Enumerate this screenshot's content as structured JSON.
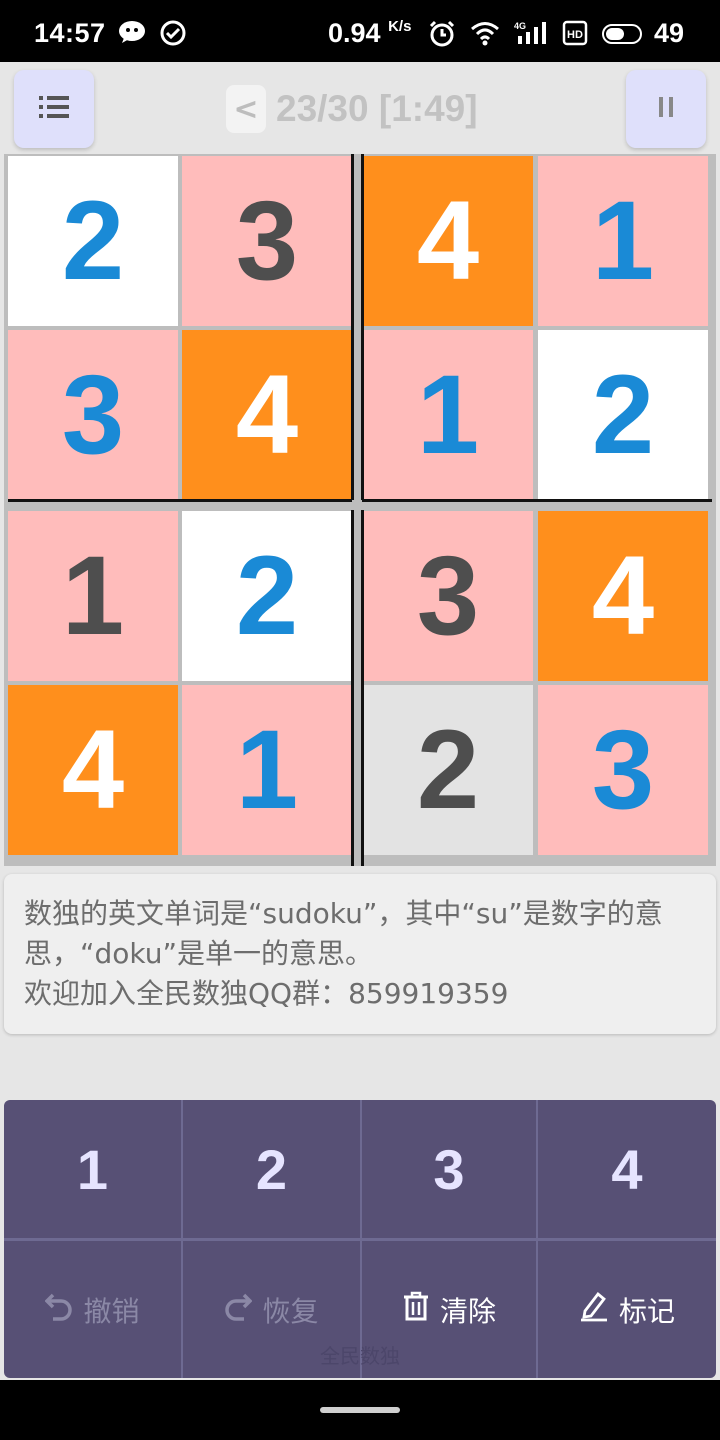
{
  "status_bar": {
    "time": "14:57",
    "net_speed": "0.94",
    "net_unit": "K/s",
    "battery_level": "49",
    "icons": [
      "wechat-icon",
      "check-circle-icon",
      "alarm-icon",
      "wifi-icon",
      "signal-4g-icon",
      "hd-icon",
      "battery-icon"
    ]
  },
  "header": {
    "back_label": "<",
    "progress": "23/30 [1:49]",
    "menu_icon": "menu-list-icon",
    "pause_icon": "pause-icon"
  },
  "board": {
    "colors": {
      "white": "#ffffff",
      "pink": "#ffbcbb",
      "orange": "#ff8f1c",
      "grey": "#e3e3e3",
      "blue": "#1a8ad6",
      "dark": "#4e4e4e",
      "light": "#ffffff"
    },
    "rows": [
      [
        {
          "value": "2",
          "bg": "white",
          "fg": "blue"
        },
        {
          "value": "3",
          "bg": "pink",
          "fg": "dark"
        },
        {
          "value": "4",
          "bg": "orange",
          "fg": "light"
        },
        {
          "value": "1",
          "bg": "pink",
          "fg": "blue"
        }
      ],
      [
        {
          "value": "3",
          "bg": "pink",
          "fg": "blue"
        },
        {
          "value": "4",
          "bg": "orange",
          "fg": "light"
        },
        {
          "value": "1",
          "bg": "pink",
          "fg": "blue"
        },
        {
          "value": "2",
          "bg": "white",
          "fg": "blue"
        }
      ],
      [
        {
          "value": "1",
          "bg": "pink",
          "fg": "dark"
        },
        {
          "value": "2",
          "bg": "white",
          "fg": "blue"
        },
        {
          "value": "3",
          "bg": "pink",
          "fg": "dark"
        },
        {
          "value": "4",
          "bg": "orange",
          "fg": "light"
        }
      ],
      [
        {
          "value": "4",
          "bg": "orange",
          "fg": "light"
        },
        {
          "value": "1",
          "bg": "pink",
          "fg": "blue"
        },
        {
          "value": "2",
          "bg": "grey",
          "fg": "dark"
        },
        {
          "value": "3",
          "bg": "pink",
          "fg": "blue"
        }
      ]
    ]
  },
  "info": {
    "line1": "数独的英文单词是“sudoku”，其中“su”是数字的意思，“doku”是单一的意思。",
    "line2": "欢迎加入全民数独QQ群：859919359"
  },
  "keypad": {
    "numbers": [
      "1",
      "2",
      "3",
      "4"
    ],
    "actions": [
      {
        "label": "撤销",
        "icon": "undo-icon",
        "enabled": false
      },
      {
        "label": "恢复",
        "icon": "redo-icon",
        "enabled": false
      },
      {
        "label": "清除",
        "icon": "trash-icon",
        "enabled": true
      },
      {
        "label": "标记",
        "icon": "pencil-icon",
        "enabled": true
      }
    ],
    "footer": "全民数独",
    "colors": {
      "enabled": "#ffffff",
      "disabled": "#8b88a6"
    }
  }
}
